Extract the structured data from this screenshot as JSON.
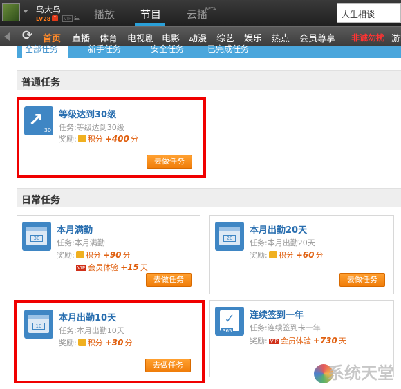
{
  "header": {
    "username": "鸟大鸟",
    "level": "LV28",
    "vip": "VIP",
    "vip_year": "年",
    "tabs": [
      "播放",
      "节目",
      "云播"
    ],
    "beta": "BETA",
    "search_value": "人生相谈"
  },
  "nav": {
    "items": [
      "首页",
      "直播",
      "体育",
      "电视剧",
      "电影",
      "动漫",
      "综艺",
      "娱乐",
      "热点",
      "会员尊享",
      "非诚勿扰",
      "游戏"
    ]
  },
  "task_tabs": [
    "全部任务",
    "新手任务",
    "安全任务",
    "已完成任务"
  ],
  "sections": {
    "normal": "普通任务",
    "daily": "日常任务"
  },
  "reward_label": "奖励:",
  "go_button": "去做任务",
  "cards": [
    {
      "title": "等级达到30级",
      "desc": "任务:等级达到30级",
      "icon_text": "30",
      "rewards": [
        {
          "icon": "coin-icon",
          "name": "积分",
          "amount": "+400",
          "unit": "分"
        }
      ]
    },
    {
      "title": "本月满勤",
      "desc": "任务:本月满勤",
      "icon_text": "30",
      "rewards": [
        {
          "icon": "coin-icon",
          "name": "积分",
          "amount": "+90",
          "unit": "分"
        },
        {
          "icon": "vip-icon",
          "icon_text": "VIP",
          "name": "会员体验",
          "amount": "+15",
          "unit": "天"
        }
      ]
    },
    {
      "title": "本月出勤20天",
      "desc": "任务:本月出勤20天",
      "icon_text": "20",
      "rewards": [
        {
          "icon": "coin-icon",
          "name": "积分",
          "amount": "+60",
          "unit": "分"
        }
      ]
    },
    {
      "title": "本月出勤10天",
      "desc": "任务:本月出勤10天",
      "icon_text": "10",
      "rewards": [
        {
          "icon": "coin-icon",
          "name": "积分",
          "amount": "+30",
          "unit": "分"
        }
      ]
    },
    {
      "title": "连续签到一年",
      "desc": "任务:连续签到卡一年",
      "icon_text": "365",
      "rewards": [
        {
          "icon": "vip-icon",
          "icon_text": "VIP",
          "name": "会员体验",
          "amount": "+730",
          "unit": "天"
        }
      ]
    }
  ],
  "watermark": "系统天堂"
}
